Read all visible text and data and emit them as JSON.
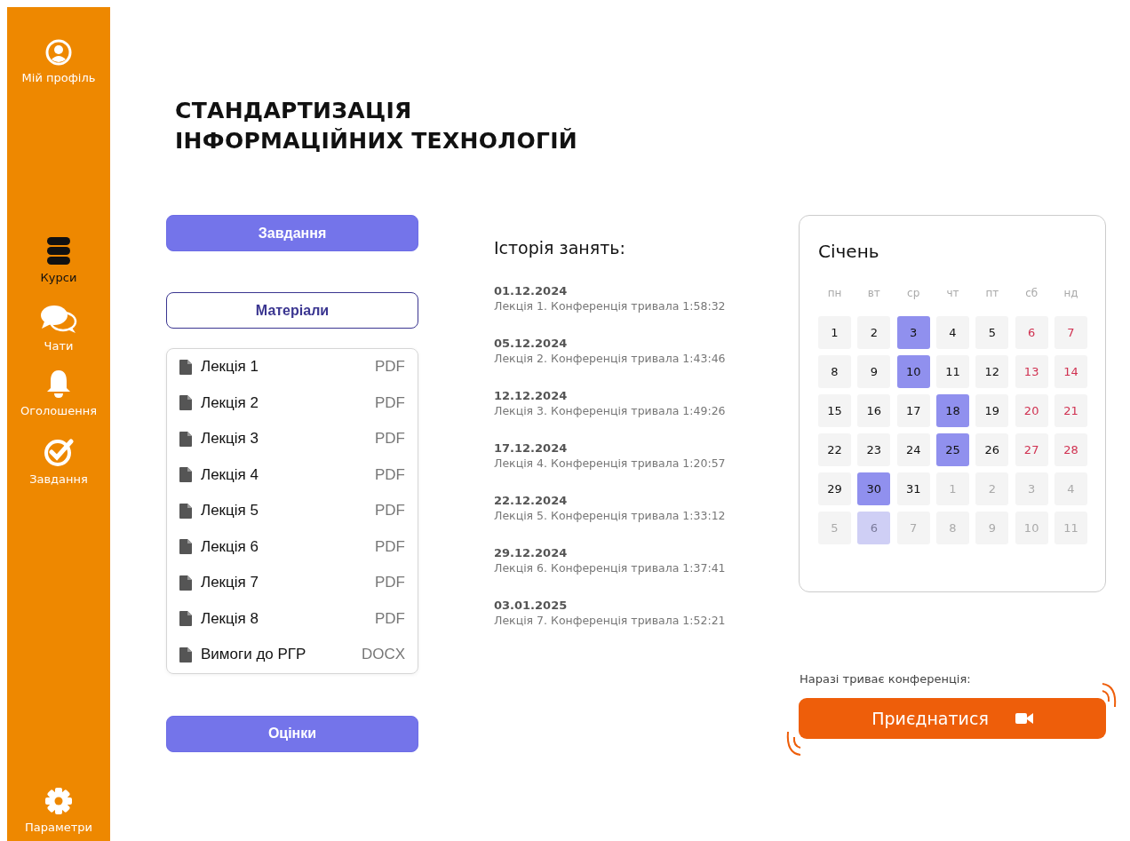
{
  "sidebar": {
    "items": [
      {
        "kind": "profile",
        "label": "Мій профіль",
        "selected": false
      },
      {
        "kind": "courses",
        "label": "Курси",
        "selected": true
      },
      {
        "kind": "chats",
        "label": "Чати",
        "selected": false
      },
      {
        "kind": "announcements",
        "label": "Оголошення",
        "selected": false
      },
      {
        "kind": "tasks",
        "label": "Завдання",
        "selected": false
      },
      {
        "kind": "settings",
        "label": "Параметри",
        "selected": false
      }
    ]
  },
  "title": [
    "СТАНДАРТИЗАЦІЯ",
    "ІНФОРМАЦІЙНИХ ТЕХНОЛОГІЙ"
  ],
  "sections": [
    {
      "label": "Завдання",
      "selected": false
    },
    {
      "label": "Матеріали",
      "selected": true
    },
    {
      "label": "Оцінки",
      "selected": false
    }
  ],
  "materials": [
    {
      "name": "Лекція 1",
      "format": "PDF"
    },
    {
      "name": "Лекція 2",
      "format": "PDF"
    },
    {
      "name": "Лекція 3",
      "format": "PDF"
    },
    {
      "name": "Лекція 4",
      "format": "PDF"
    },
    {
      "name": "Лекція 5",
      "format": "PDF"
    },
    {
      "name": "Лекція 6",
      "format": "PDF"
    },
    {
      "name": "Лекція 7",
      "format": "PDF"
    },
    {
      "name": "Лекція 8",
      "format": "PDF"
    },
    {
      "name": "Вимоги до РГР",
      "format": "DOCX"
    }
  ],
  "history": {
    "title": "Історія занять:",
    "entries": [
      {
        "date": "01.12.2024",
        "text": "Лекція 1. Конференція тривала 1:58:32"
      },
      {
        "date": "05.12.2024",
        "text": "Лекція 2. Конференція тривала 1:43:46"
      },
      {
        "date": "12.12.2024",
        "text": "Лекція 3. Конференція тривала 1:49:26"
      },
      {
        "date": "17.12.2024",
        "text": "Лекція 4. Конференція тривала 1:20:57"
      },
      {
        "date": "22.12.2024",
        "text": "Лекція 5. Конференція тривала 1:33:12"
      },
      {
        "date": "29.12.2024",
        "text": "Лекція 6. Конференція тривала 1:37:41"
      },
      {
        "date": "03.01.2025",
        "text": "Лекція 7. Конференція тривала 1:52:21"
      }
    ]
  },
  "calendar": {
    "month": "Січень",
    "weekdays": [
      "пн",
      "вт",
      "ср",
      "чт",
      "пт",
      "сб",
      "нд"
    ],
    "days": [
      {
        "day": "1",
        "outside": false,
        "weekend": false,
        "marked": false
      },
      {
        "day": "2",
        "outside": false,
        "weekend": false,
        "marked": false
      },
      {
        "day": "3",
        "outside": false,
        "weekend": false,
        "marked": true
      },
      {
        "day": "4",
        "outside": false,
        "weekend": false,
        "marked": false
      },
      {
        "day": "5",
        "outside": false,
        "weekend": false,
        "marked": false
      },
      {
        "day": "6",
        "outside": false,
        "weekend": true,
        "marked": false
      },
      {
        "day": "7",
        "outside": false,
        "weekend": true,
        "marked": false
      },
      {
        "day": "8",
        "outside": false,
        "weekend": false,
        "marked": false
      },
      {
        "day": "9",
        "outside": false,
        "weekend": false,
        "marked": false
      },
      {
        "day": "10",
        "outside": false,
        "weekend": false,
        "marked": true
      },
      {
        "day": "11",
        "outside": false,
        "weekend": false,
        "marked": false
      },
      {
        "day": "12",
        "outside": false,
        "weekend": false,
        "marked": false
      },
      {
        "day": "13",
        "outside": false,
        "weekend": true,
        "marked": false
      },
      {
        "day": "14",
        "outside": false,
        "weekend": true,
        "marked": false
      },
      {
        "day": "15",
        "outside": false,
        "weekend": false,
        "marked": false
      },
      {
        "day": "16",
        "outside": false,
        "weekend": false,
        "marked": false
      },
      {
        "day": "17",
        "outside": false,
        "weekend": false,
        "marked": false
      },
      {
        "day": "18",
        "outside": false,
        "weekend": false,
        "marked": true
      },
      {
        "day": "19",
        "outside": false,
        "weekend": false,
        "marked": false
      },
      {
        "day": "20",
        "outside": false,
        "weekend": true,
        "marked": false
      },
      {
        "day": "21",
        "outside": false,
        "weekend": true,
        "marked": false
      },
      {
        "day": "22",
        "outside": false,
        "weekend": false,
        "marked": false
      },
      {
        "day": "23",
        "outside": false,
        "weekend": false,
        "marked": false
      },
      {
        "day": "24",
        "outside": false,
        "weekend": false,
        "marked": false
      },
      {
        "day": "25",
        "outside": false,
        "weekend": false,
        "marked": true
      },
      {
        "day": "26",
        "outside": false,
        "weekend": false,
        "marked": false
      },
      {
        "day": "27",
        "outside": false,
        "weekend": true,
        "marked": false
      },
      {
        "day": "28",
        "outside": false,
        "weekend": true,
        "marked": false
      },
      {
        "day": "29",
        "outside": false,
        "weekend": false,
        "marked": false
      },
      {
        "day": "30",
        "outside": false,
        "weekend": false,
        "marked": true
      },
      {
        "day": "31",
        "outside": false,
        "weekend": false,
        "marked": false
      },
      {
        "day": "1",
        "outside": true,
        "weekend": false,
        "marked": false
      },
      {
        "day": "2",
        "outside": true,
        "weekend": false,
        "marked": false
      },
      {
        "day": "3",
        "outside": true,
        "weekend": false,
        "marked": false
      },
      {
        "day": "4",
        "outside": true,
        "weekend": false,
        "marked": false
      },
      {
        "day": "5",
        "outside": true,
        "weekend": false,
        "marked": false
      },
      {
        "day": "6",
        "outside": true,
        "weekend": false,
        "marked": true
      },
      {
        "day": "7",
        "outside": true,
        "weekend": false,
        "marked": false
      },
      {
        "day": "8",
        "outside": true,
        "weekend": false,
        "marked": false
      },
      {
        "day": "9",
        "outside": true,
        "weekend": false,
        "marked": false
      },
      {
        "day": "10",
        "outside": true,
        "weekend": false,
        "marked": false
      },
      {
        "day": "11",
        "outside": true,
        "weekend": false,
        "marked": false
      }
    ]
  },
  "conference": {
    "label": "Наразі триває конференція:",
    "button": "Приєднатися"
  }
}
